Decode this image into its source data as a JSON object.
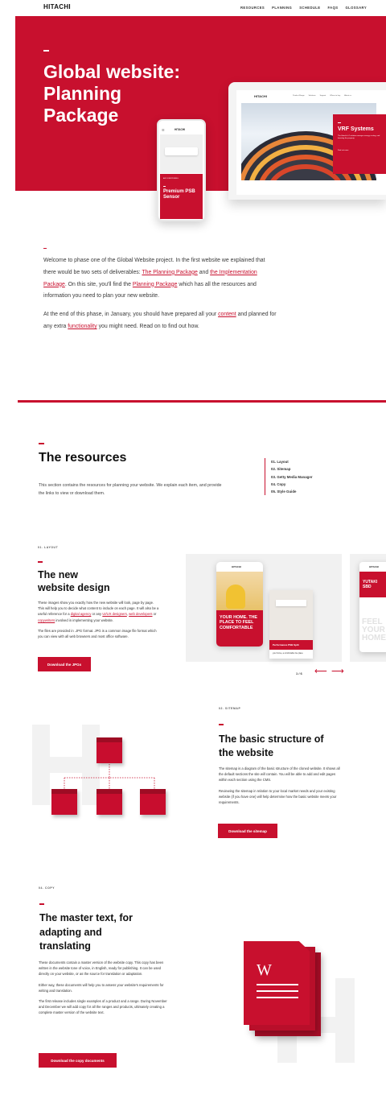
{
  "header": {
    "logo": "HITACHI",
    "nav": [
      "RESOURCES",
      "PLANNING",
      "SCHEDULE",
      "FAQS",
      "GLOSSARY"
    ]
  },
  "hero": {
    "title_lines": [
      "Global website:",
      "Planning",
      "Package"
    ],
    "phone": {
      "logo": "HITACHI",
      "small_label": "AIR CONDITIONING",
      "card_title": "Premium PSB Sensor"
    },
    "laptop": {
      "logo": "HITACHI",
      "nav": [
        "Product Range",
        "Solutions",
        "Support",
        "Where to buy",
        "About us"
      ],
      "card_title": "VRF Systems",
      "card_text": "The Hitachi IoT solution manages energy costing, and boosting the property.",
      "card_link": "Find out more"
    }
  },
  "intro": {
    "p1_a": "Welcome to phase one of the Global Website project. In the first website we explained that there would be two sets of deliverables: ",
    "p1_link1": "The Planning Package",
    "p1_b": " and ",
    "p1_link2": "the Implementation Package",
    "p1_c": ". On this site, you'll find the ",
    "p1_link3": "Planning Package",
    "p1_d": " which has all the resources and information you need to plan your new website.",
    "p2_a": "At the end of this phase, in January, you should have prepared all your ",
    "p2_link1": "content",
    "p2_b": " and planned for any extra ",
    "p2_link2": "functionality",
    "p2_c": " you might need. Read on to find out how."
  },
  "resources": {
    "title": "The resources",
    "text": "This section contains the resources for planning your website. We explain each item, and provide the links to view or download them.",
    "list": [
      "01. Layout",
      "02. Sitemap",
      "03. Getty Media Manager",
      "04. Copy",
      "05. Style Guide"
    ]
  },
  "layout": {
    "label": "01. LAYOUT",
    "title_lines": [
      "The new",
      "website design"
    ],
    "p1_a": "These images show you exactly how the new website will look, page by page. This will help you to decide what content to include on each page. It will also be a useful reference for a ",
    "p1_link1": "digital agency",
    "p1_b": " or any ",
    "p1_link2": "UI/UX designers",
    "p1_c": ", ",
    "p1_link3": "web developers",
    "p1_d": " or ",
    "p1_link4": "copywriters",
    "p1_e": " involved in implementing your website.",
    "p2": "The files are provided in .JPG format. JPG is a common image file format which you can view with all web browsers and most office software.",
    "button": "Download the JPGs",
    "pager": "1 / 6",
    "mock1": {
      "logo": "HITACHI",
      "card_title": "YOUR HOME. THE PLACE TO FEEL COMFORTABLE",
      "card2_title": "Performance PSB Split",
      "card3_text": "your home, a comfortable live place"
    },
    "mock2": {
      "logo": "HITACHI",
      "card_title": "YUTAKI SBD",
      "bg_text": "FEEL YOUR HOME"
    }
  },
  "sitemap": {
    "label": "02. SITEMAP",
    "title_lines": [
      "The basic structure of",
      "the website"
    ],
    "p1": "The sitemap is a diagram of the basic structure of the cloned website. It shows all the default sections the site will contain. You will be able to add and edit pages within each section using the CMS.",
    "p2": "Reviewing the sitemap in relation to your local market needs and your existing website (if you have one) will help determine how the basic website meets your requirements.",
    "button": "Download the sitemap"
  },
  "copy": {
    "label": "04. COPY",
    "title_lines": [
      "The master text, for",
      "adapting and",
      "translating"
    ],
    "p1": "These documents contain a master version of the website copy. This copy has been written in the website tone of voice, in English, ready for publishing. It can be used directly on your website, or as the source for translation or adaptation.",
    "p2": "Either way, these documents will help you to assess your website's requirements for writing and translation.",
    "p3": "The first release includes single examples of a product and a range. During November and December we will add copy for all the ranges and products, ultimately creating a complete master version of the website text.",
    "button": "Download the copy documents",
    "doc_letter": "W"
  },
  "colors": {
    "brand": "#c8102e"
  }
}
